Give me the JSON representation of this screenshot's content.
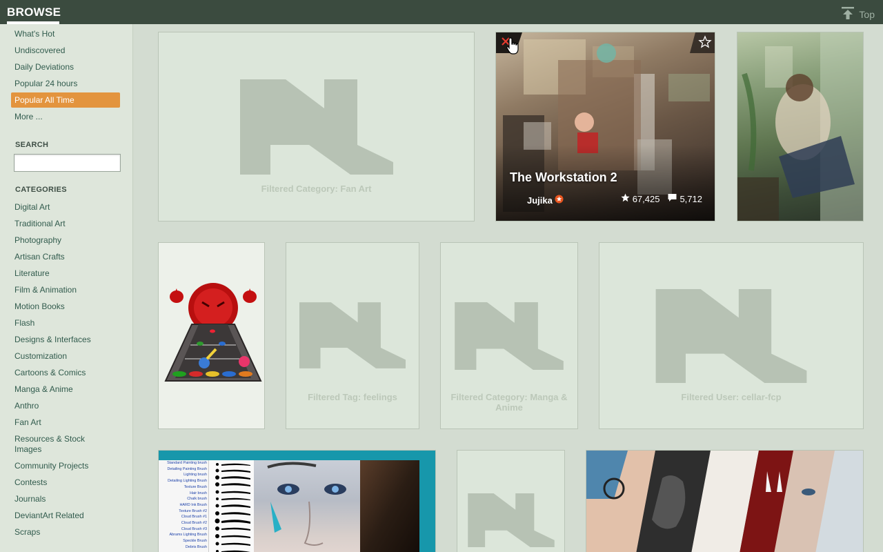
{
  "header": {
    "title": "BROWSE",
    "top_label": "Top"
  },
  "nav": {
    "items": [
      {
        "label": "What's Hot",
        "active": false
      },
      {
        "label": "Undiscovered",
        "active": false
      },
      {
        "label": "Daily Deviations",
        "active": false
      },
      {
        "label": "Popular 24 hours",
        "active": false
      },
      {
        "label": "Popular All Time",
        "active": true
      },
      {
        "label": "More ...",
        "active": false
      }
    ]
  },
  "search": {
    "label": "SEARCH",
    "value": "",
    "placeholder": ""
  },
  "categories": {
    "label": "CATEGORIES",
    "items": [
      "Digital Art",
      "Traditional Art",
      "Photography",
      "Artisan Crafts",
      "Literature",
      "Film & Animation",
      "Motion Books",
      "Flash",
      "Designs & Interfaces",
      "Customization",
      "Cartoons & Comics",
      "Manga & Anime",
      "Anthro",
      "Fan Art",
      "Resources & Stock Images",
      "Community Projects",
      "Contests",
      "Journals",
      "DeviantArt Related",
      "Scraps"
    ]
  },
  "tiles": {
    "filtered_fan_art": "Filtered Category: Fan Art",
    "workstation": {
      "title": "The Workstation 2",
      "author": "Jujika",
      "favourites": "67,425",
      "comments": "5,712"
    },
    "filtered_tag_feelings": "Filtered Tag: feelings",
    "filtered_manga": "Filtered Category: Manga & Anime",
    "filtered_user": "Filtered User: cellar-fcp"
  },
  "brush_list": [
    "Standard Painting brush",
    "Detailing Painting Brush",
    "Lighting brush",
    "Detailing Lighting Brush",
    "Texture Brush",
    "Hair brush",
    "Chalk brush",
    "HARD Ink Brush",
    "Texture Brush #2",
    "Cloud Brush #1",
    "Cloud Brush #2",
    "Cloud Brush #3",
    "Abrams Lighting Brush",
    "Speckle Brush",
    "Debris Brush"
  ],
  "colors": {
    "topbar": "#3b4b3f",
    "sidebar": "#dee6db",
    "active": "#e3943e",
    "link": "#315b4d",
    "canvas": "#d3dcd1",
    "tile": "#dce6da"
  }
}
